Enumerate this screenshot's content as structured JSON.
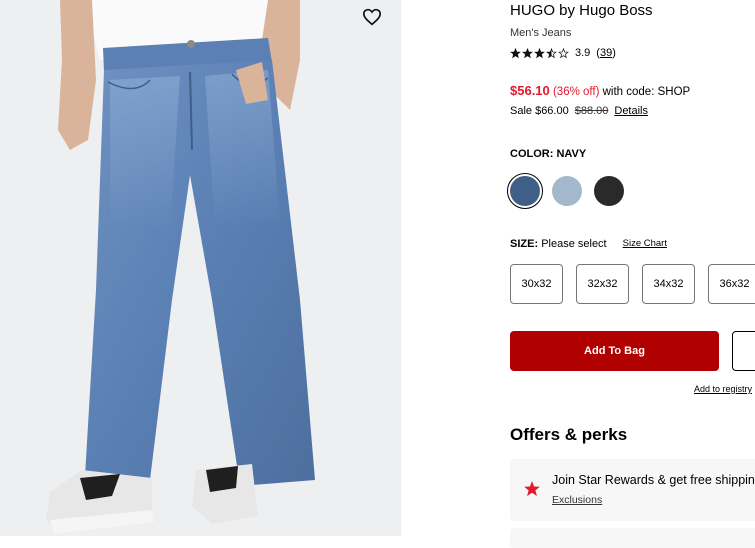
{
  "product": {
    "brand": "HUGO by Hugo Boss",
    "name": "Men's Jeans",
    "rating_value": 3.9,
    "rating_text": "3.9",
    "review_count": "39",
    "stars_filled": 3.5,
    "stars_total": 5
  },
  "pricing": {
    "promo_price": "$56.10",
    "discount": "(36% off)",
    "promo_code_text": "with code: SHOP",
    "sale_text": "Sale $66.00",
    "original_price": "$88.00",
    "details_link": "Details"
  },
  "color": {
    "label": "COLOR:",
    "selected": "NAVY",
    "swatches": [
      {
        "name": "navy",
        "color": "#3f5f86"
      },
      {
        "name": "light-blue",
        "color": "#a3b8cc"
      },
      {
        "name": "black",
        "color": "#2a2a2a"
      }
    ]
  },
  "size": {
    "label": "SIZE:",
    "prompt": "Please select",
    "chart_link": "Size Chart",
    "options": [
      "30x32",
      "32x32",
      "34x32",
      "36x32"
    ]
  },
  "actions": {
    "add_to_bag": "Add To Bag",
    "add_to_registry": "Add to registry"
  },
  "offers": {
    "heading": "Offers & perks",
    "perk_title": "Join Star Rewards & get free shipping",
    "perk_link": "Exclusions"
  },
  "icons": {
    "favorite": "heart-outline-icon",
    "perk": "red-star-icon"
  },
  "colors": {
    "sale_red": "#e21a2c",
    "add_to_bag_bg": "#b00000"
  }
}
